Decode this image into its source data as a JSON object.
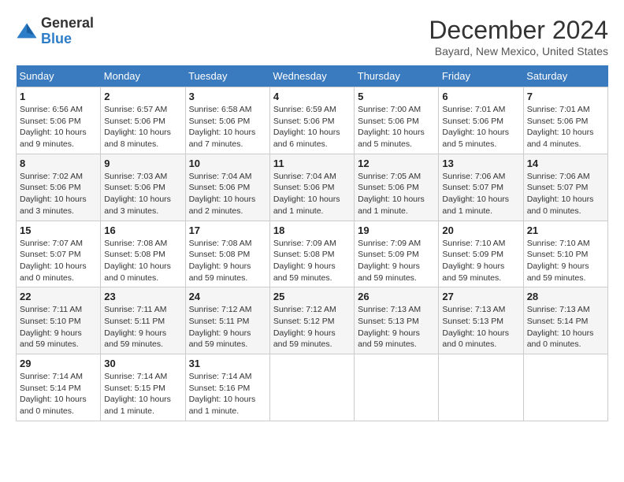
{
  "header": {
    "logo": {
      "general": "General",
      "blue": "Blue",
      "tagline": "General\nBlue"
    },
    "title": "December 2024",
    "location": "Bayard, New Mexico, United States"
  },
  "weekdays": [
    "Sunday",
    "Monday",
    "Tuesday",
    "Wednesday",
    "Thursday",
    "Friday",
    "Saturday"
  ],
  "weeks": [
    [
      {
        "day": "1",
        "sunrise": "6:56 AM",
        "sunset": "5:06 PM",
        "daylight": "10 hours and 9 minutes."
      },
      {
        "day": "2",
        "sunrise": "6:57 AM",
        "sunset": "5:06 PM",
        "daylight": "10 hours and 8 minutes."
      },
      {
        "day": "3",
        "sunrise": "6:58 AM",
        "sunset": "5:06 PM",
        "daylight": "10 hours and 7 minutes."
      },
      {
        "day": "4",
        "sunrise": "6:59 AM",
        "sunset": "5:06 PM",
        "daylight": "10 hours and 6 minutes."
      },
      {
        "day": "5",
        "sunrise": "7:00 AM",
        "sunset": "5:06 PM",
        "daylight": "10 hours and 5 minutes."
      },
      {
        "day": "6",
        "sunrise": "7:01 AM",
        "sunset": "5:06 PM",
        "daylight": "10 hours and 5 minutes."
      },
      {
        "day": "7",
        "sunrise": "7:01 AM",
        "sunset": "5:06 PM",
        "daylight": "10 hours and 4 minutes."
      }
    ],
    [
      {
        "day": "8",
        "sunrise": "7:02 AM",
        "sunset": "5:06 PM",
        "daylight": "10 hours and 3 minutes."
      },
      {
        "day": "9",
        "sunrise": "7:03 AM",
        "sunset": "5:06 PM",
        "daylight": "10 hours and 3 minutes."
      },
      {
        "day": "10",
        "sunrise": "7:04 AM",
        "sunset": "5:06 PM",
        "daylight": "10 hours and 2 minutes."
      },
      {
        "day": "11",
        "sunrise": "7:04 AM",
        "sunset": "5:06 PM",
        "daylight": "10 hours and 1 minute."
      },
      {
        "day": "12",
        "sunrise": "7:05 AM",
        "sunset": "5:06 PM",
        "daylight": "10 hours and 1 minute."
      },
      {
        "day": "13",
        "sunrise": "7:06 AM",
        "sunset": "5:07 PM",
        "daylight": "10 hours and 1 minute."
      },
      {
        "day": "14",
        "sunrise": "7:06 AM",
        "sunset": "5:07 PM",
        "daylight": "10 hours and 0 minutes."
      }
    ],
    [
      {
        "day": "15",
        "sunrise": "7:07 AM",
        "sunset": "5:07 PM",
        "daylight": "10 hours and 0 minutes."
      },
      {
        "day": "16",
        "sunrise": "7:08 AM",
        "sunset": "5:08 PM",
        "daylight": "10 hours and 0 minutes."
      },
      {
        "day": "17",
        "sunrise": "7:08 AM",
        "sunset": "5:08 PM",
        "daylight": "9 hours and 59 minutes."
      },
      {
        "day": "18",
        "sunrise": "7:09 AM",
        "sunset": "5:08 PM",
        "daylight": "9 hours and 59 minutes."
      },
      {
        "day": "19",
        "sunrise": "7:09 AM",
        "sunset": "5:09 PM",
        "daylight": "9 hours and 59 minutes."
      },
      {
        "day": "20",
        "sunrise": "7:10 AM",
        "sunset": "5:09 PM",
        "daylight": "9 hours and 59 minutes."
      },
      {
        "day": "21",
        "sunrise": "7:10 AM",
        "sunset": "5:10 PM",
        "daylight": "9 hours and 59 minutes."
      }
    ],
    [
      {
        "day": "22",
        "sunrise": "7:11 AM",
        "sunset": "5:10 PM",
        "daylight": "9 hours and 59 minutes."
      },
      {
        "day": "23",
        "sunrise": "7:11 AM",
        "sunset": "5:11 PM",
        "daylight": "9 hours and 59 minutes."
      },
      {
        "day": "24",
        "sunrise": "7:12 AM",
        "sunset": "5:11 PM",
        "daylight": "9 hours and 59 minutes."
      },
      {
        "day": "25",
        "sunrise": "7:12 AM",
        "sunset": "5:12 PM",
        "daylight": "9 hours and 59 minutes."
      },
      {
        "day": "26",
        "sunrise": "7:13 AM",
        "sunset": "5:13 PM",
        "daylight": "9 hours and 59 minutes."
      },
      {
        "day": "27",
        "sunrise": "7:13 AM",
        "sunset": "5:13 PM",
        "daylight": "10 hours and 0 minutes."
      },
      {
        "day": "28",
        "sunrise": "7:13 AM",
        "sunset": "5:14 PM",
        "daylight": "10 hours and 0 minutes."
      }
    ],
    [
      {
        "day": "29",
        "sunrise": "7:14 AM",
        "sunset": "5:14 PM",
        "daylight": "10 hours and 0 minutes."
      },
      {
        "day": "30",
        "sunrise": "7:14 AM",
        "sunset": "5:15 PM",
        "daylight": "10 hours and 1 minute."
      },
      {
        "day": "31",
        "sunrise": "7:14 AM",
        "sunset": "5:16 PM",
        "daylight": "10 hours and 1 minute."
      },
      null,
      null,
      null,
      null
    ]
  ]
}
